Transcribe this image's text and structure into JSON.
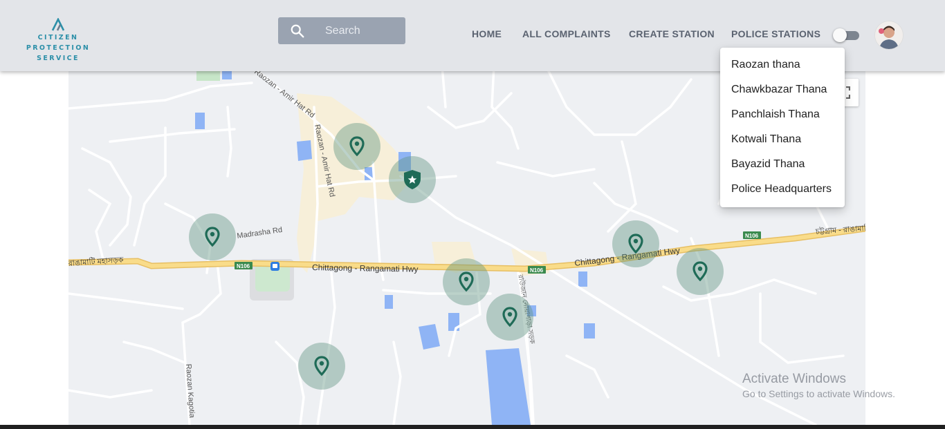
{
  "header": {
    "logo_lines": [
      "CITIZEN",
      "PROTECTION",
      "SERVICE"
    ],
    "search_placeholder": "Search",
    "nav": {
      "home": "HOME",
      "all_complaints": "ALL COMPLAINTS",
      "create_station": "CREATE STATION",
      "police_stations": "POLICE STATIONS"
    },
    "theme_toggle_on": false
  },
  "dropdown": {
    "items": [
      "Raozan thana",
      "Chawkbazar Thana",
      "Panchlaish Thana",
      "Kotwali Thana",
      "Bayazid Thana",
      "Police Headquarters"
    ]
  },
  "map": {
    "road_labels": {
      "amir_hat_1": "Raozan - Amir Hat Rd",
      "amir_hat_2": "Raozan - Amir Hat Rd",
      "madrasha": "Madrasha Rd",
      "hwy_1": "Chittagong - Rangamati Hwy",
      "hwy_2": "Chittagong - Rangamati Hwy",
      "kagotia": "Raozan Kagotia",
      "bengali_west": "রাঙামাটি মহাসড়ক",
      "bengali_east": "চট্টগ্রাম - রাঙামাটি",
      "bengali_vertical": "রাউজান নোয়াপাড়া সড়ক"
    },
    "route_shields": [
      "N106",
      "N106",
      "N106"
    ],
    "markers_count": 8,
    "station_markers_count": 1,
    "colors": {
      "marker_fill": "#1f6b57",
      "highway": "#f6d27a",
      "water": "#8fb4f5"
    }
  },
  "watermark": {
    "title": "Activate Windows",
    "subtitle": "Go to Settings to activate Windows."
  }
}
